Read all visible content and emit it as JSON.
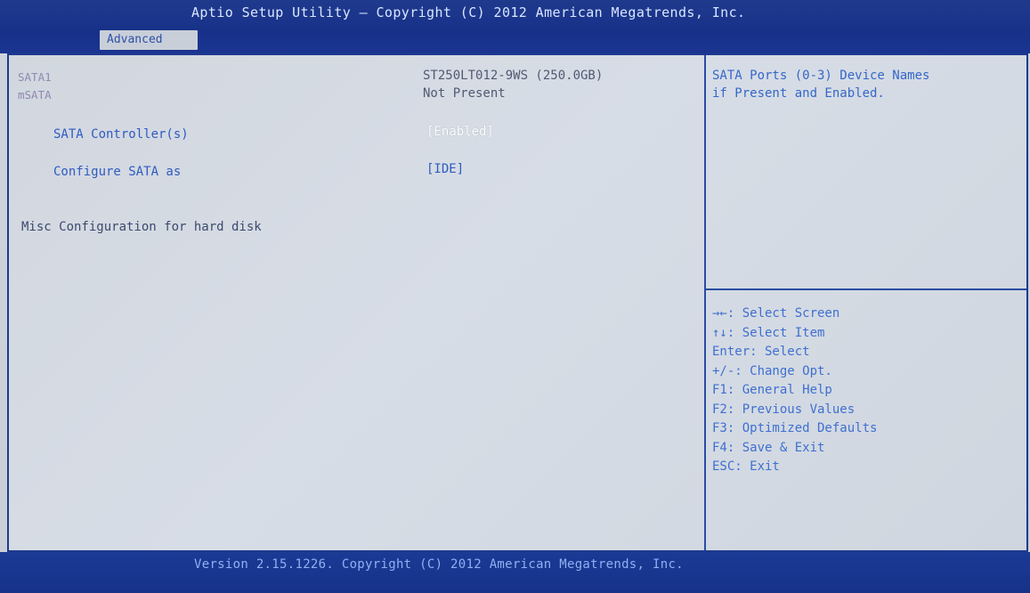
{
  "header": {
    "title": "Aptio Setup Utility – Copyright (C) 2012 American Megatrends, Inc.",
    "active_tab": "Advanced"
  },
  "main": {
    "devices": [
      {
        "label": "SATA1",
        "value": "ST250LT012-9WS (250.0GB)"
      },
      {
        "label": "mSATA",
        "value": "Not Present"
      }
    ],
    "settings": [
      {
        "label": "SATA Controller(s)",
        "value": "[Enabled]"
      },
      {
        "label": "Configure SATA as",
        "value": "[IDE]"
      }
    ],
    "misc_note": "Misc Configuration for hard disk"
  },
  "help": {
    "description": [
      "SATA Ports (0-3) Device Names",
      "if Present and Enabled."
    ],
    "keys": [
      "→←: Select Screen",
      "↑↓: Select Item",
      "Enter: Select",
      "+/-: Change Opt.",
      "F1: General Help",
      "F2: Previous Values",
      "F3: Optimized Defaults",
      "F4: Save & Exit",
      "ESC: Exit"
    ]
  },
  "footer": {
    "version": "Version 2.15.1226. Copyright (C) 2012 American Megatrends, Inc."
  },
  "colors": {
    "bar_blue": "#17318a",
    "panel_bg": "#d2d7df",
    "highlight_white": "#ffffff",
    "help_blue": "#3567c9"
  }
}
